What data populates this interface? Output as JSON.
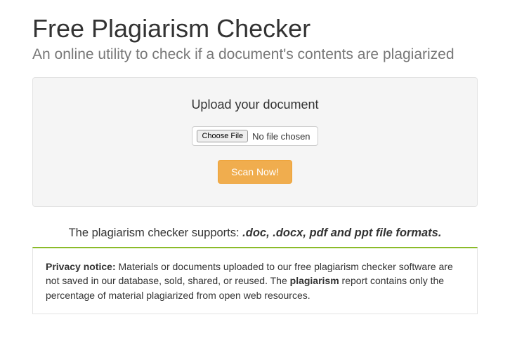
{
  "header": {
    "title": "Free Plagiarism Checker",
    "subtitle": "An online utility to check if a document's contents are plagiarized"
  },
  "upload": {
    "title": "Upload your document",
    "choose_file_label": "Choose File",
    "file_status": "No file chosen",
    "scan_button": "Scan Now!"
  },
  "supports": {
    "prefix": "The plagiarism checker supports: ",
    "formats": ".doc, .docx, pdf and ppt file formats."
  },
  "notice": {
    "label": "Privacy notice:",
    "part1": " Materials or documents uploaded to our free plagiarism checker software are not saved in our database, sold, shared, or reused. The ",
    "bold_word": "plagiarism",
    "part2": " report contains only the percentage of material plagiarized from open web resources."
  }
}
